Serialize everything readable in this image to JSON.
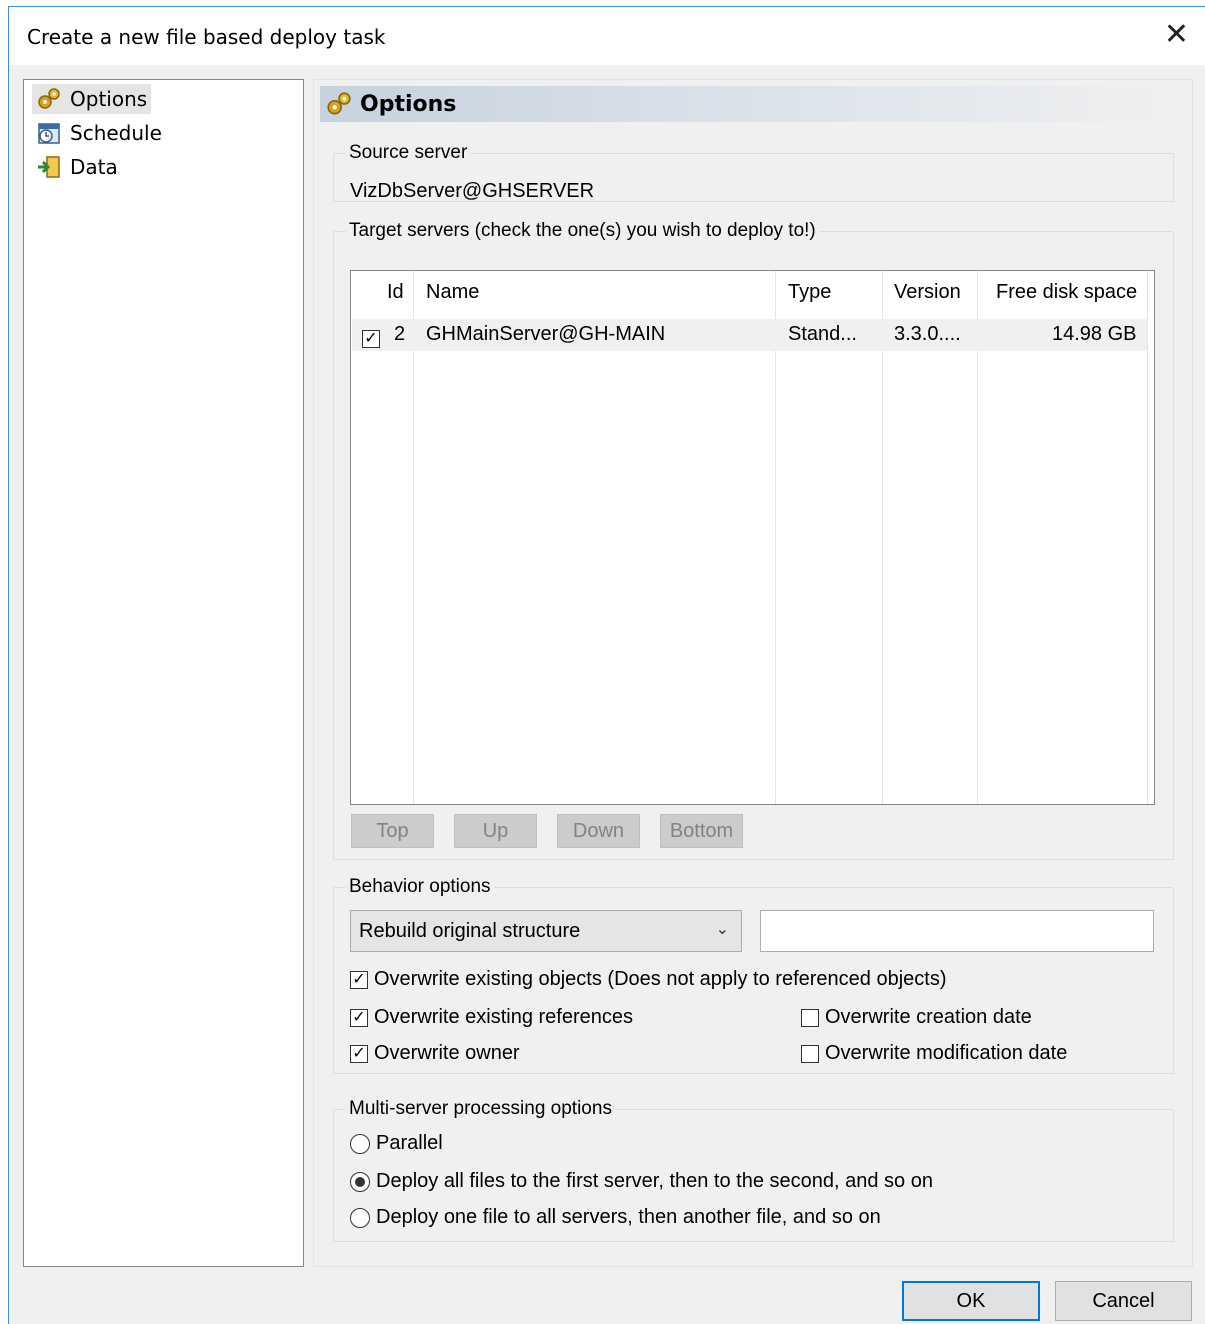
{
  "window": {
    "title": "Create a new file based deploy task",
    "close_glyph": "✕"
  },
  "nav": {
    "items": [
      {
        "label": "Options",
        "icon": "gears-icon"
      },
      {
        "label": "Schedule",
        "icon": "schedule-icon"
      },
      {
        "label": "Data",
        "icon": "data-import-icon"
      }
    ]
  },
  "banner": {
    "title": "Options"
  },
  "source_server": {
    "legend": "Source server",
    "value": "VizDbServer@GHSERVER"
  },
  "target_servers": {
    "legend": "Target servers (check the one(s) you wish to deploy to!)",
    "columns": [
      "Id",
      "Name",
      "Type",
      "Version",
      "Free disk space"
    ],
    "rows": [
      {
        "checked": true,
        "id": "2",
        "name": "GHMainServer@GH-MAIN",
        "type": "Stand...",
        "version": "3.3.0....",
        "free": "14.98 GB"
      }
    ],
    "buttons": [
      "Top",
      "Up",
      "Down",
      "Bottom"
    ]
  },
  "behavior": {
    "legend": "Behavior options",
    "dropdown_value": "Rebuild original structure",
    "textbox_value": "",
    "options": {
      "overwrite_objects": {
        "label": "Overwrite existing objects (Does not apply to referenced objects)",
        "checked": true
      },
      "overwrite_references": {
        "label": "Overwrite existing references",
        "checked": true
      },
      "overwrite_owner": {
        "label": "Overwrite owner",
        "checked": true
      },
      "overwrite_creation": {
        "label": "Overwrite creation date",
        "checked": false
      },
      "overwrite_modification": {
        "label": "Overwrite modification date",
        "checked": false
      }
    }
  },
  "multi_server": {
    "legend": "Multi-server processing options",
    "options": [
      {
        "label": "Parallel",
        "selected": false
      },
      {
        "label": "Deploy all files to the first server, then to the second, and so on",
        "selected": true
      },
      {
        "label": "Deploy one file to all servers, then another file, and so on",
        "selected": false
      }
    ]
  },
  "footer": {
    "ok": "OK",
    "cancel": "Cancel"
  },
  "colors": {
    "accent": "#0078d7",
    "dialog_bg": "#f0f0f0",
    "border": "#3c8fd6"
  }
}
